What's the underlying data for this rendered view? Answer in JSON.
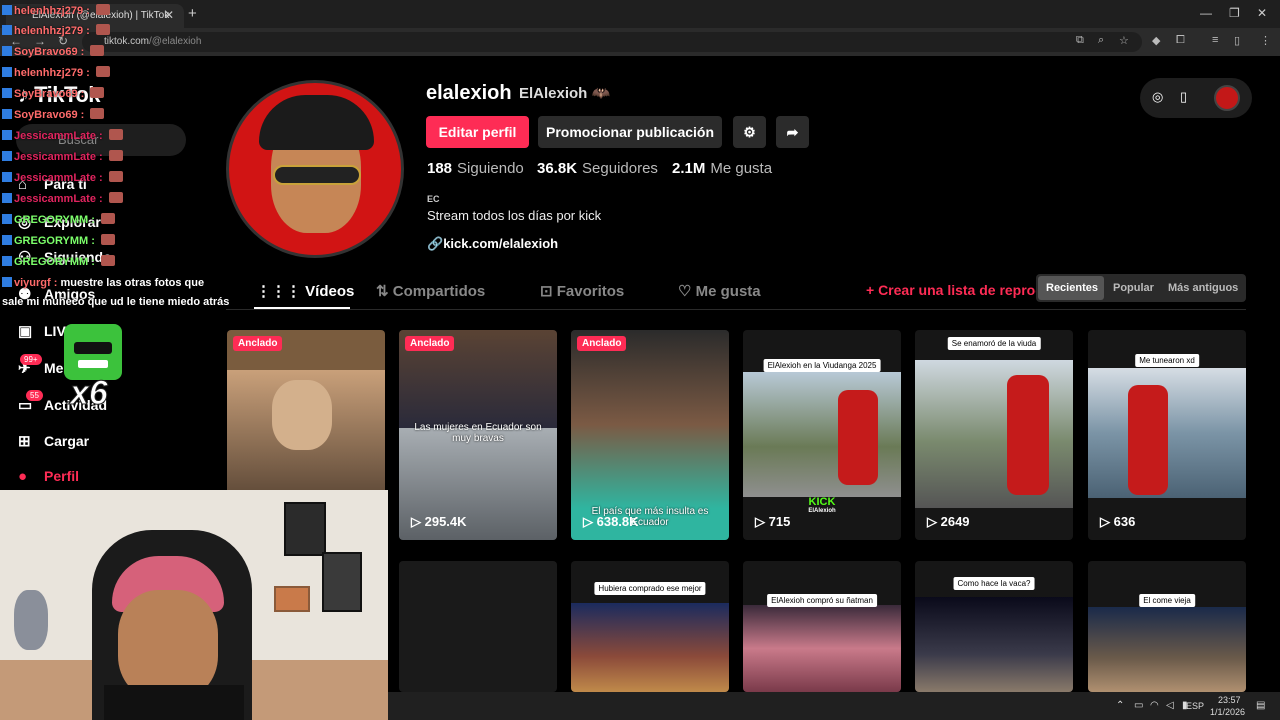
{
  "browser": {
    "tab_title": "ElAlexioh (@elalexioh) | TikTok",
    "url_host": "tiktok.com",
    "url_path": "/@elalexioh"
  },
  "sidebar": {
    "logo": "TikTok",
    "search_placeholder": "Buscar",
    "items": [
      {
        "label": "Para ti",
        "icon": "home-icon"
      },
      {
        "label": "Explorar",
        "icon": "compass-icon"
      },
      {
        "label": "Siguiendo",
        "icon": "following-icon"
      },
      {
        "label": "Amigos",
        "icon": "friends-icon"
      },
      {
        "label": "LIVE",
        "icon": "live-icon"
      },
      {
        "label": "Mensajes",
        "icon": "message-icon",
        "badge": "99+"
      },
      {
        "label": "Actividad",
        "icon": "activity-icon",
        "badge": "55"
      },
      {
        "label": "Cargar",
        "icon": "upload-icon"
      },
      {
        "label": "Perfil",
        "icon": "profile-avatar-icon"
      }
    ]
  },
  "profile": {
    "username": "elalexioh",
    "nickname": "ElAlexioh",
    "edit_label": "Editar perfil",
    "promote_label": "Promocionar publicación",
    "stats": [
      {
        "value": "188",
        "label": "Siguiendo"
      },
      {
        "value": "36.8K",
        "label": "Seguidores"
      },
      {
        "value": "2.1M",
        "label": "Me gusta"
      }
    ],
    "region": "EC",
    "bio": "Stream todos los días por kick",
    "link": "kick.com/elalexioh"
  },
  "tabs": {
    "videos": "Vídeos",
    "shared": "Compartidos",
    "favorites": "Favoritos",
    "liked": "Me gusta",
    "create_list": "+ Crear una lista de reproducción",
    "sort": [
      "Recientes",
      "Popular",
      "Más antiguos"
    ]
  },
  "videos": [
    {
      "pinned": "Anclado",
      "views": "",
      "caption": ""
    },
    {
      "pinned": "Anclado",
      "views": "295.4K",
      "caption": "Las mujeres en Ecuador son muy bravas"
    },
    {
      "pinned": "Anclado",
      "views": "638.8K",
      "caption": "El país que más insulta es Ecuador"
    },
    {
      "pinned": "",
      "views": "715",
      "caption": "ElAlexioh en la Viudanga 2025"
    },
    {
      "pinned": "",
      "views": "2649",
      "caption": "Se enamoró de la viuda"
    },
    {
      "pinned": "",
      "views": "636",
      "caption": "Me tunearon xd"
    },
    {
      "pinned": "",
      "views": "",
      "caption": ""
    },
    {
      "pinned": "",
      "views": "",
      "caption": "Hubiera comprado ese mejor"
    },
    {
      "pinned": "",
      "views": "",
      "caption": "ElAlexioh compró su ñatman"
    },
    {
      "pinned": "",
      "views": "",
      "caption": "Como hace la vaca?"
    },
    {
      "pinned": "",
      "views": "",
      "caption": "El come vieja"
    }
  ],
  "kick_watermark": {
    "brand": "KICK",
    "name": "ElAlexioh"
  },
  "overlay": {
    "chat": [
      {
        "user": "helenhhzj279",
        "color": "#ff6b6b",
        "msg": ""
      },
      {
        "user": "helenhhzj279",
        "color": "#ff6b6b",
        "msg": ""
      },
      {
        "user": "SoyBravo69",
        "color": "#ff6b6b",
        "msg": ""
      },
      {
        "user": "helenhhzj279",
        "color": "#ff6b6b",
        "msg": ""
      },
      {
        "user": "SoyBravo69",
        "color": "#ff6b6b",
        "msg": ""
      },
      {
        "user": "SoyBravo69",
        "color": "#ff6b6b",
        "msg": ""
      },
      {
        "user": "JessicammLate",
        "color": "#e0245e",
        "msg": ""
      },
      {
        "user": "JessicammLate",
        "color": "#e0245e",
        "msg": ""
      },
      {
        "user": "JessicammLate",
        "color": "#e0245e",
        "msg": ""
      },
      {
        "user": "JessicammLate",
        "color": "#e0245e",
        "msg": ""
      },
      {
        "user": "GREGORYMM",
        "color": "#7cff6b",
        "msg": ""
      },
      {
        "user": "GREGORYMM",
        "color": "#7cff6b",
        "msg": ""
      },
      {
        "user": "GREGORYMM",
        "color": "#7cff6b",
        "msg": ""
      },
      {
        "user": "viyurgf",
        "color": "#ff6b6b",
        "msg": "muestre las otras fotos que"
      },
      {
        "user": "",
        "color": "#ffffff",
        "msg": "sale mi muñeco que ud le tiene miedo atrás"
      }
    ],
    "multiplier": "x6"
  },
  "taskbar": {
    "lang": "ESP",
    "time": "23:57",
    "date": "1/1/2026"
  }
}
